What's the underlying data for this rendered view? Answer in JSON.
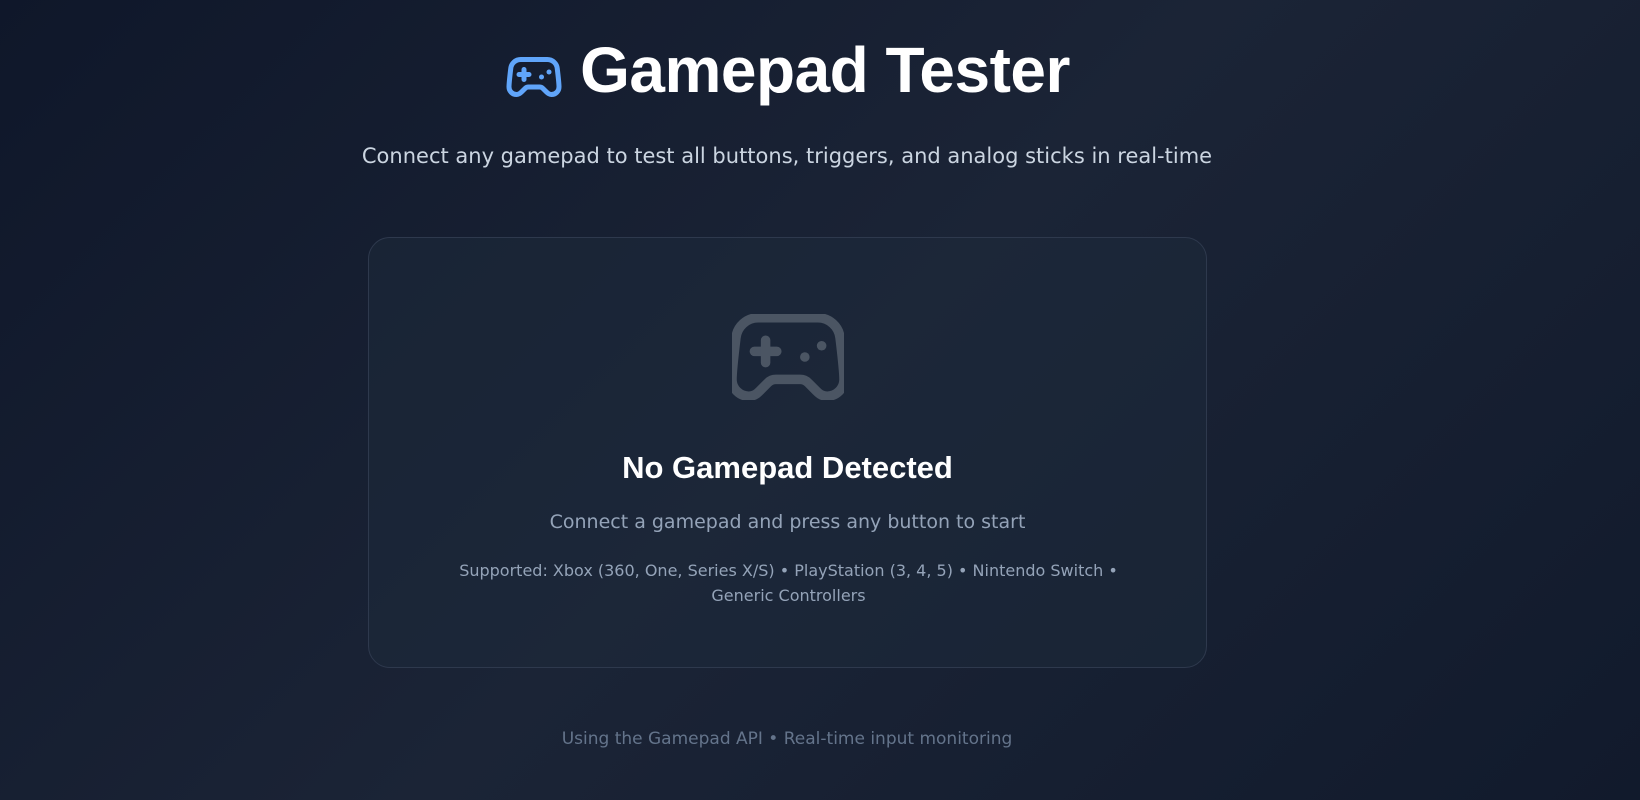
{
  "header": {
    "title": "Gamepad Tester",
    "icon": "gamepad-icon",
    "accent_color": "#60a5fa"
  },
  "subtitle": "Connect any gamepad to test all buttons, triggers, and analog sticks in real-time",
  "status_card": {
    "icon": "gamepad-icon",
    "icon_color": "#4b5563",
    "title": "No Gamepad Detected",
    "message": "Connect a gamepad and press any button to start",
    "supported": "Supported: Xbox (360, One, Series X/S) • PlayStation (3, 4, 5) • Nintendo Switch • Generic Controllers"
  },
  "footer": "Using the Gamepad API • Real-time input monitoring"
}
